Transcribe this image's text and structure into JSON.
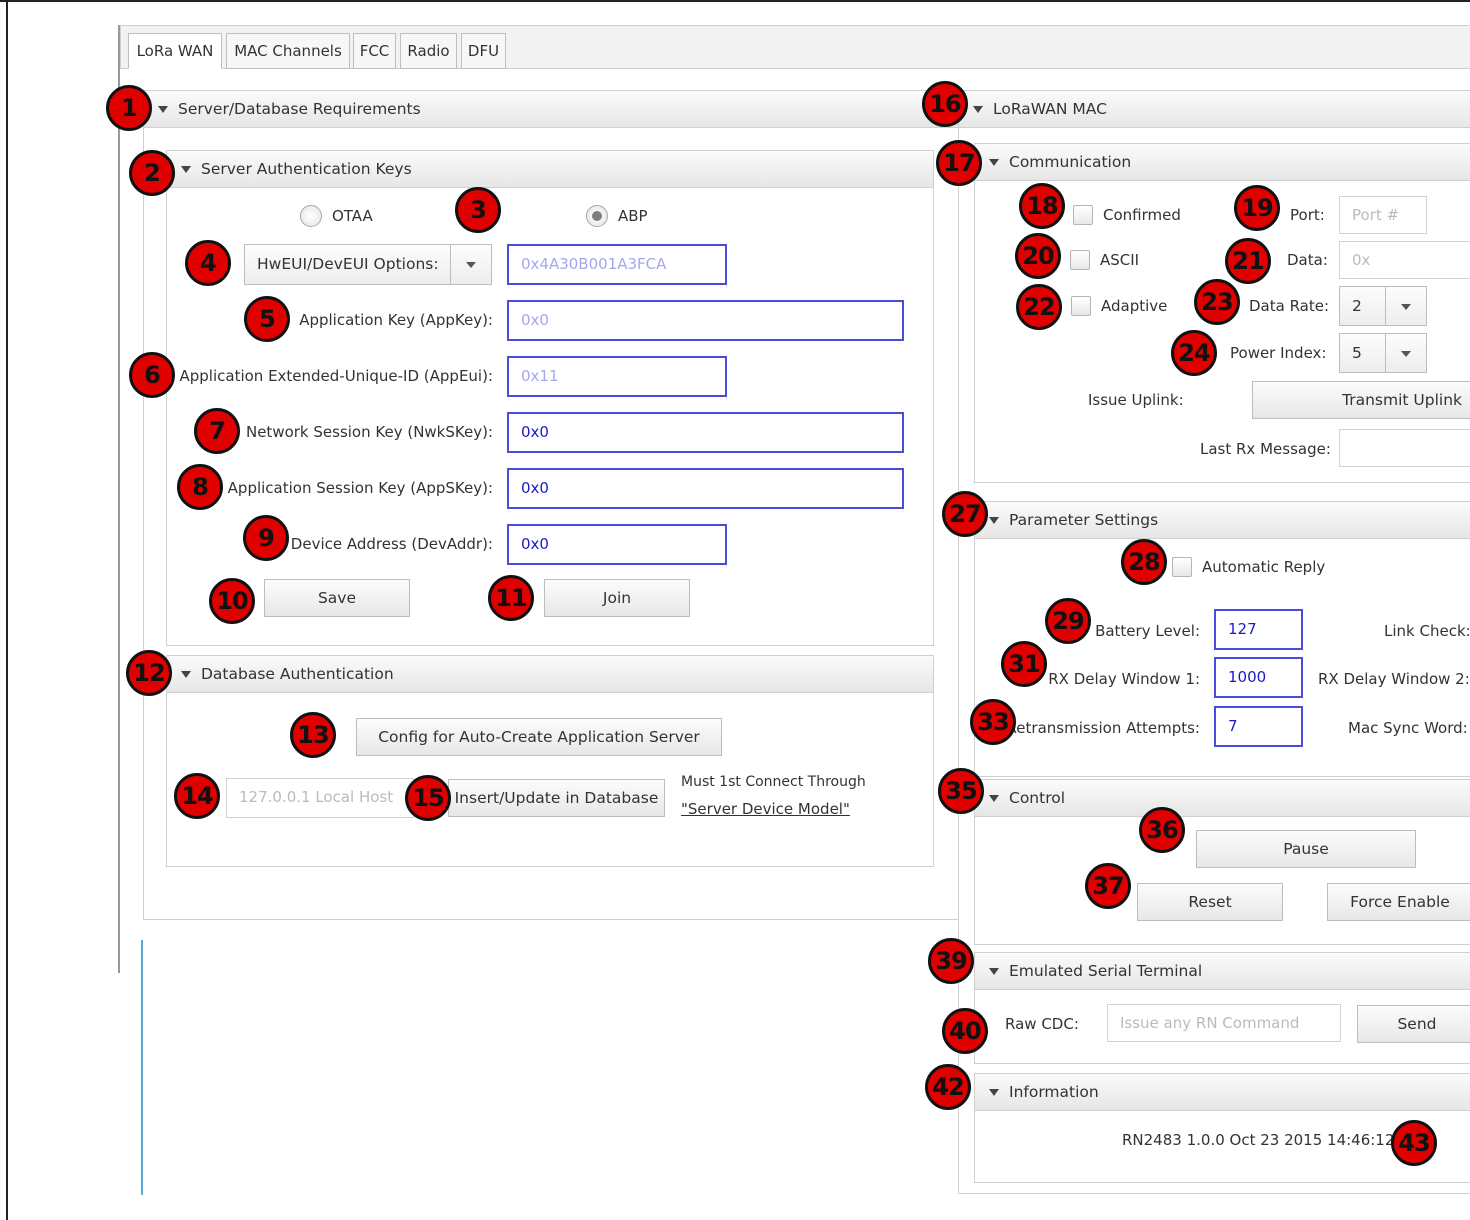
{
  "tabs": [
    "LoRa WAN",
    "MAC Channels",
    "FCC",
    "Radio",
    "DFU"
  ],
  "server_db": {
    "header": "Server/Database Requirements",
    "auth_keys": {
      "header": "Server Authentication Keys",
      "radio_otaa": "OTAA",
      "radio_abp": "ABP",
      "selected_mode": "ABP",
      "eui_select": "HwEUI/DevEUI Options:",
      "eui_value": "0x4A30B001A3FCA",
      "appkey_label": "Application Key (AppKey):",
      "appkey_value": "0x0",
      "appeui_label": "Application Extended-Unique-ID (AppEui):",
      "appeui_value": "0x11",
      "nwkskey_label": "Network Session Key (NwkSKey):",
      "nwkskey_value": "0x0",
      "appskey_label": "Application Session Key (AppSKey):",
      "appskey_value": "0x0",
      "devaddr_label": "Device Address (DevAddr):",
      "devaddr_value": "0x0",
      "save_label": "Save",
      "join_label": "Join"
    },
    "db_auth": {
      "header": "Database Authentication",
      "config_button": "Config for Auto-Create Application Server",
      "host_placeholder": "127.0.0.1 Local Host",
      "insert_button": "Insert/Update in Database",
      "note": "Must 1st Connect Through",
      "link": "\"Server Device Model\""
    }
  },
  "lorawan_mac": {
    "header": "LoRaWAN MAC",
    "communication": {
      "header": "Communication",
      "confirmed": "Confirmed",
      "ascii": "ASCII",
      "adaptive": "Adaptive",
      "port_label": "Port:",
      "port_placeholder": "Port #",
      "data_label": "Data:",
      "data_placeholder": "0x",
      "data_rate_label": "Data Rate:",
      "data_rate_value": "2",
      "power_index_label": "Power Index:",
      "power_index_value": "5",
      "issue_uplink_label": "Issue Uplink:",
      "transmit_button": "Transmit Uplink",
      "last_rx_label": "Last Rx Message:"
    },
    "parameters": {
      "header": "Parameter Settings",
      "auto_reply": "Automatic Reply",
      "battery_label": "Battery Level:",
      "battery_value": "127",
      "link_check_label": "Link Check:",
      "rx1_label": "RX Delay Window 1:",
      "rx1_value": "1000",
      "rx2_label": "RX Delay Window 2:",
      "retrans_label": "Retransmission Attempts:",
      "retrans_value": "7",
      "sync_label": "Mac Sync Word:"
    },
    "control": {
      "header": "Control",
      "pause": "Pause",
      "reset": "Reset",
      "force_enable": "Force Enable"
    },
    "serial": {
      "header": "Emulated Serial Terminal",
      "raw_label": "Raw CDC:",
      "placeholder": "Issue any RN Command",
      "send": "Send"
    },
    "info": {
      "header": "Information",
      "version": "RN2483 1.0.0 Oct 23 2015 14:46:12"
    }
  },
  "badges": [
    "1",
    "2",
    "3",
    "4",
    "5",
    "6",
    "7",
    "8",
    "9",
    "10",
    "11",
    "12",
    "13",
    "14",
    "15",
    "16",
    "17",
    "18",
    "19",
    "20",
    "21",
    "22",
    "23",
    "24",
    "27",
    "28",
    "29",
    "31",
    "33",
    "35",
    "36",
    "37",
    "39",
    "40",
    "42",
    "43"
  ],
  "colors": {
    "badge": "#e00000",
    "input_border": "#4a4adc",
    "input_text": "#1a1ac8"
  }
}
